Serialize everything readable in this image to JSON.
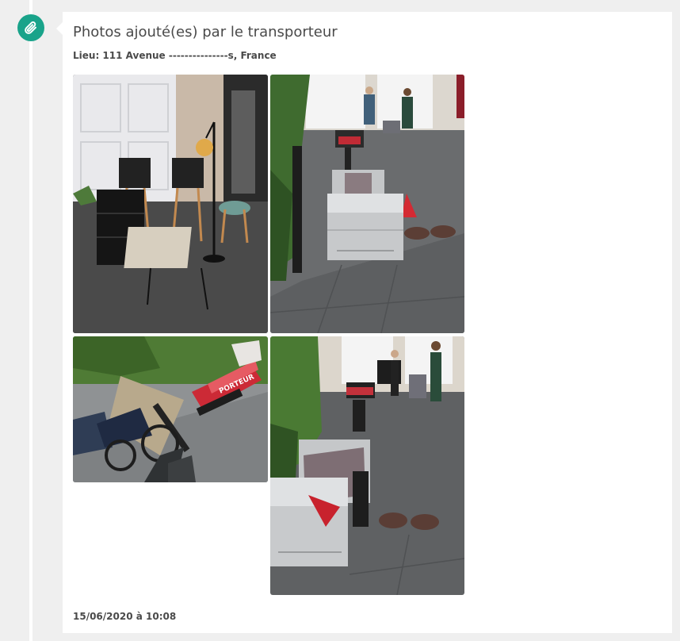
{
  "event": {
    "icon": "paperclip-icon",
    "accent_color": "#19a38a",
    "title": "Photos ajouté(es) par le transporteur",
    "location": "Lieu: 111 Avenue ---------------s, France",
    "timestamp": "15/06/2020 à 10:08"
  },
  "photos": [
    {
      "subject": "furniture-on-driveway"
    },
    {
      "subject": "cargo-bike-trailer-rear-view"
    },
    {
      "subject": "cargo-bike-side-view",
      "sign_text": "PORTEUR"
    },
    {
      "subject": "cargo-bike-trailer-front-view"
    }
  ]
}
